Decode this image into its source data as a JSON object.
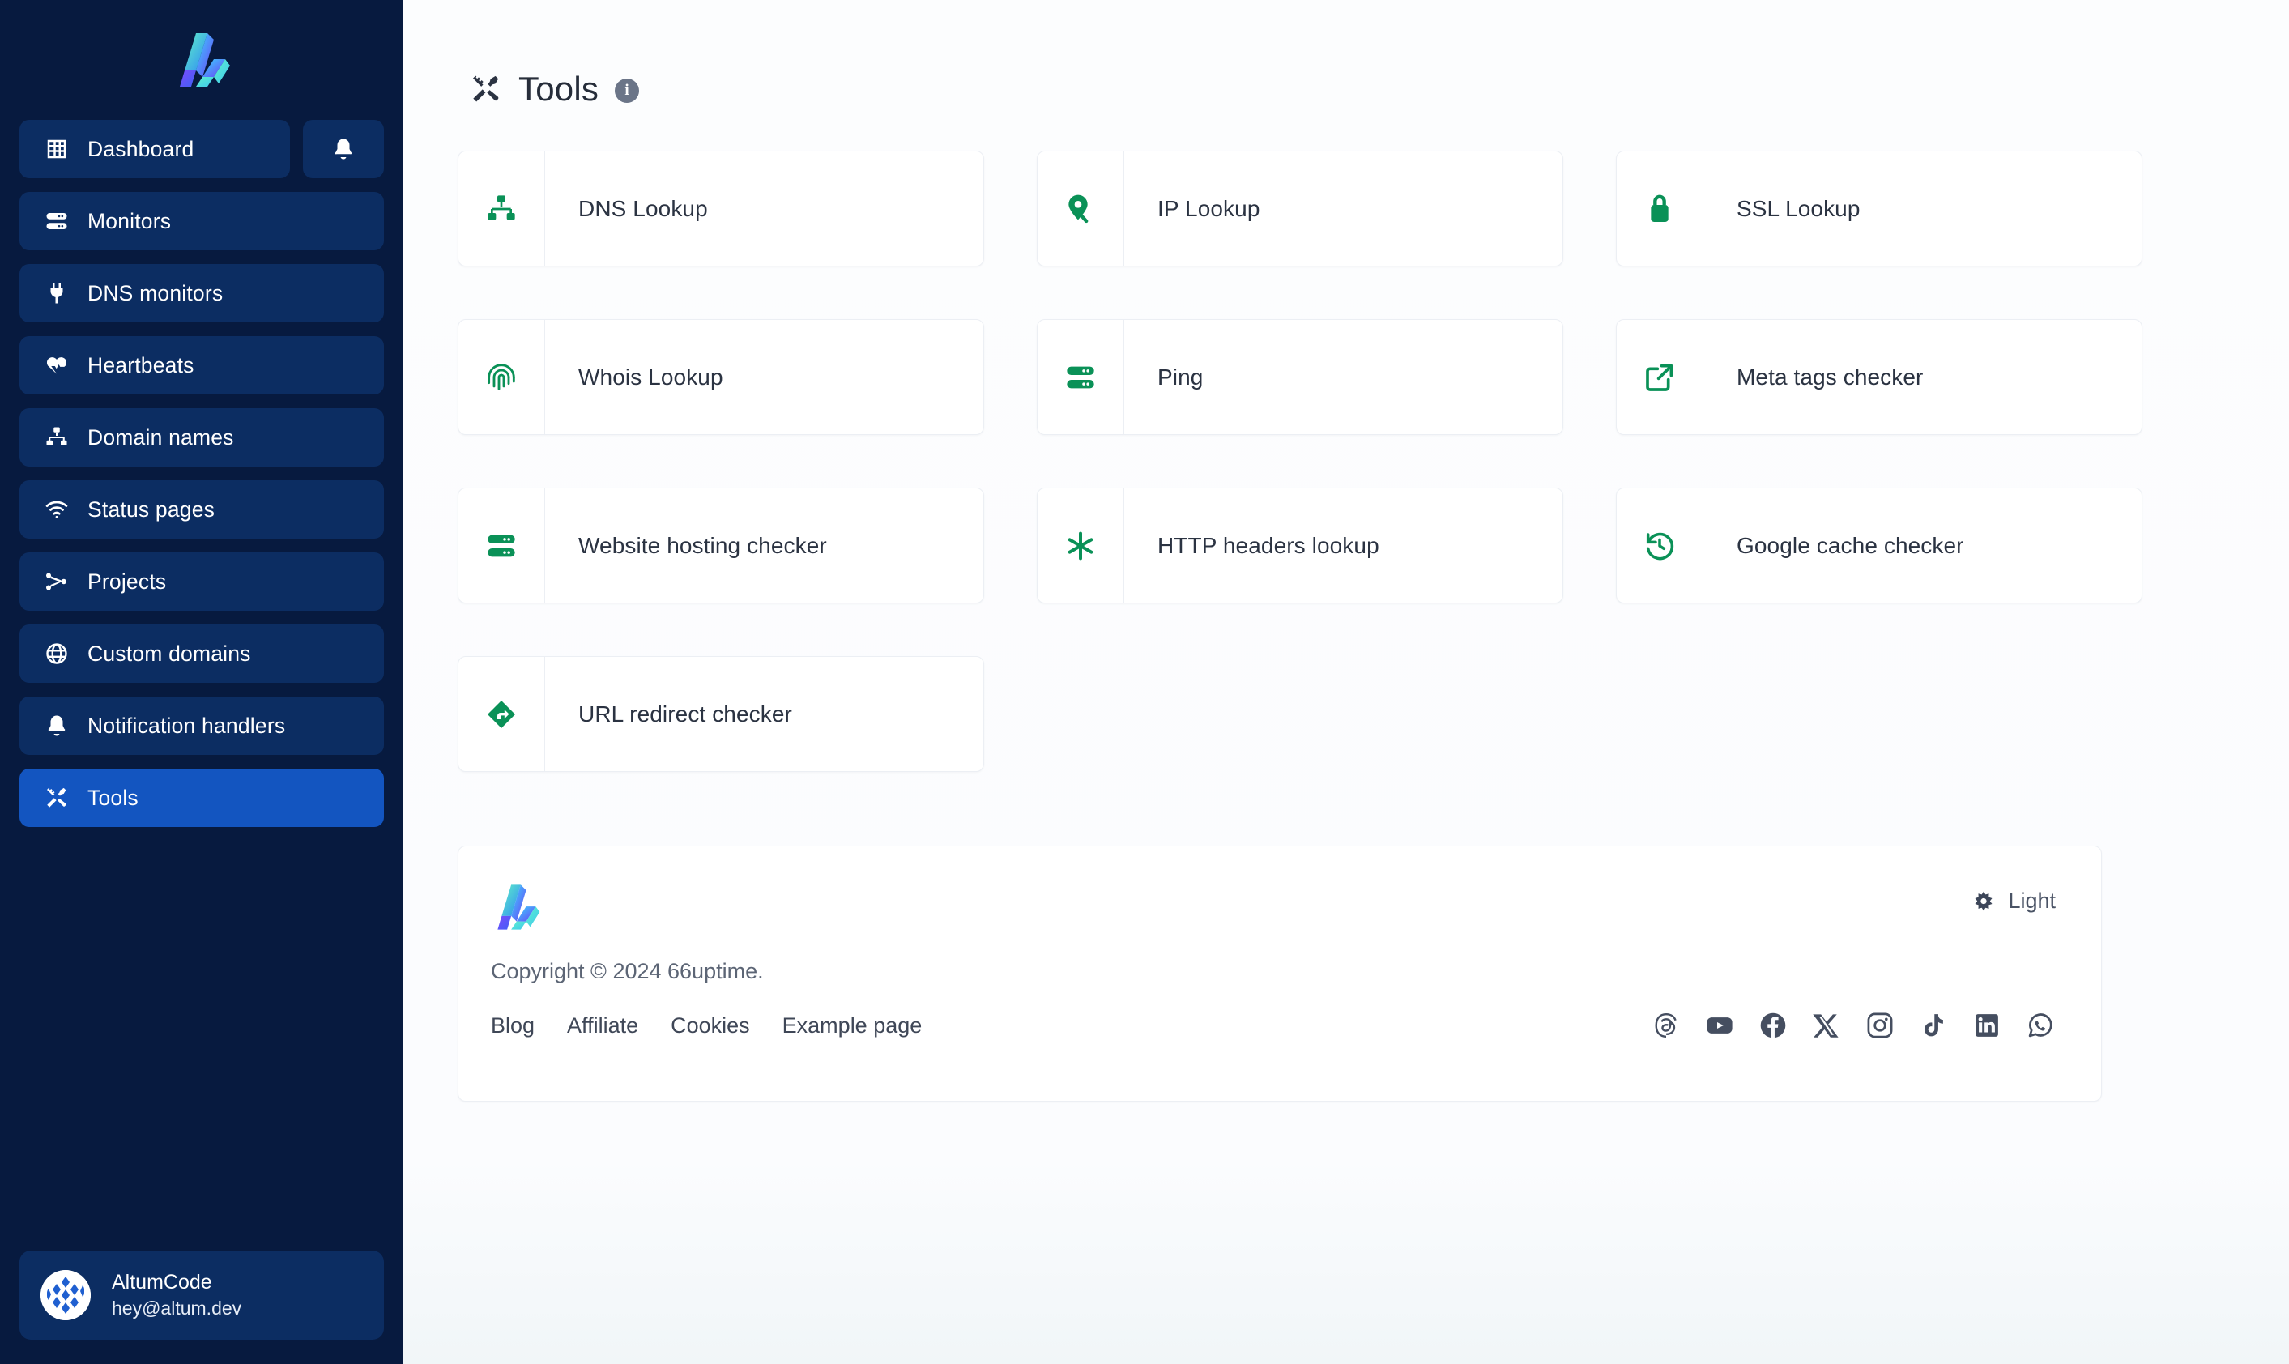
{
  "sidebar": {
    "logo_icon": "altum-logo-icon",
    "nav": [
      {
        "label": "Dashboard",
        "icon": "grid-icon",
        "active": false
      },
      {
        "label": "Monitors",
        "icon": "server-icon",
        "active": false
      },
      {
        "label": "DNS monitors",
        "icon": "plug-icon",
        "active": false
      },
      {
        "label": "Heartbeats",
        "icon": "heart-pulse-icon",
        "active": false
      },
      {
        "label": "Domain names",
        "icon": "sitemap-icon",
        "active": false
      },
      {
        "label": "Status pages",
        "icon": "wifi-icon",
        "active": false
      },
      {
        "label": "Projects",
        "icon": "project-nodes-icon",
        "active": false
      },
      {
        "label": "Custom domains",
        "icon": "globe-icon",
        "active": false
      },
      {
        "label": "Notification handlers",
        "icon": "bell-icon",
        "active": false
      },
      {
        "label": "Tools",
        "icon": "wrench-screwdriver-icon",
        "active": true
      }
    ],
    "notifications_icon": "bell-icon",
    "user": {
      "name": "AltumCode",
      "email": "hey@altum.dev",
      "avatar_icon": "user-avatar"
    }
  },
  "header": {
    "icon": "wrench-screwdriver-icon",
    "title": "Tools",
    "info_icon": "info-icon",
    "info_label": "i"
  },
  "tools": [
    {
      "label": "DNS Lookup",
      "icon": "sitemap-icon"
    },
    {
      "label": "IP Lookup",
      "icon": "map-pin-search-icon"
    },
    {
      "label": "SSL Lookup",
      "icon": "lock-icon"
    },
    {
      "label": "Whois Lookup",
      "icon": "fingerprint-icon"
    },
    {
      "label": "Ping",
      "icon": "server-icon"
    },
    {
      "label": "Meta tags checker",
      "icon": "external-link-icon"
    },
    {
      "label": "Website hosting checker",
      "icon": "server-icon"
    },
    {
      "label": "HTTP headers lookup",
      "icon": "asterisk-icon"
    },
    {
      "label": "Google cache checker",
      "icon": "history-icon"
    },
    {
      "label": "URL redirect checker",
      "icon": "redirect-diamond-icon"
    }
  ],
  "footer": {
    "logo_icon": "altum-logo-icon",
    "theme": {
      "icon": "sun-icon",
      "label": "Light"
    },
    "copyright": "Copyright © 2024 66uptime.",
    "links": [
      {
        "label": "Blog"
      },
      {
        "label": "Affiliate"
      },
      {
        "label": "Cookies"
      },
      {
        "label": "Example page"
      }
    ],
    "socials": [
      {
        "name": "threads-icon"
      },
      {
        "name": "youtube-icon"
      },
      {
        "name": "facebook-icon"
      },
      {
        "name": "x-icon"
      },
      {
        "name": "instagram-icon"
      },
      {
        "name": "tiktok-icon"
      },
      {
        "name": "linkedin-icon"
      },
      {
        "name": "whatsapp-icon"
      }
    ]
  },
  "colors": {
    "sidebar_bg": "#071a3f",
    "nav_item_bg": "#0c2d62",
    "nav_active_bg": "#1355c0",
    "tool_icon_green": "#0a9157",
    "main_bg": "#fbfcfe",
    "text_dark": "#2b3342"
  }
}
